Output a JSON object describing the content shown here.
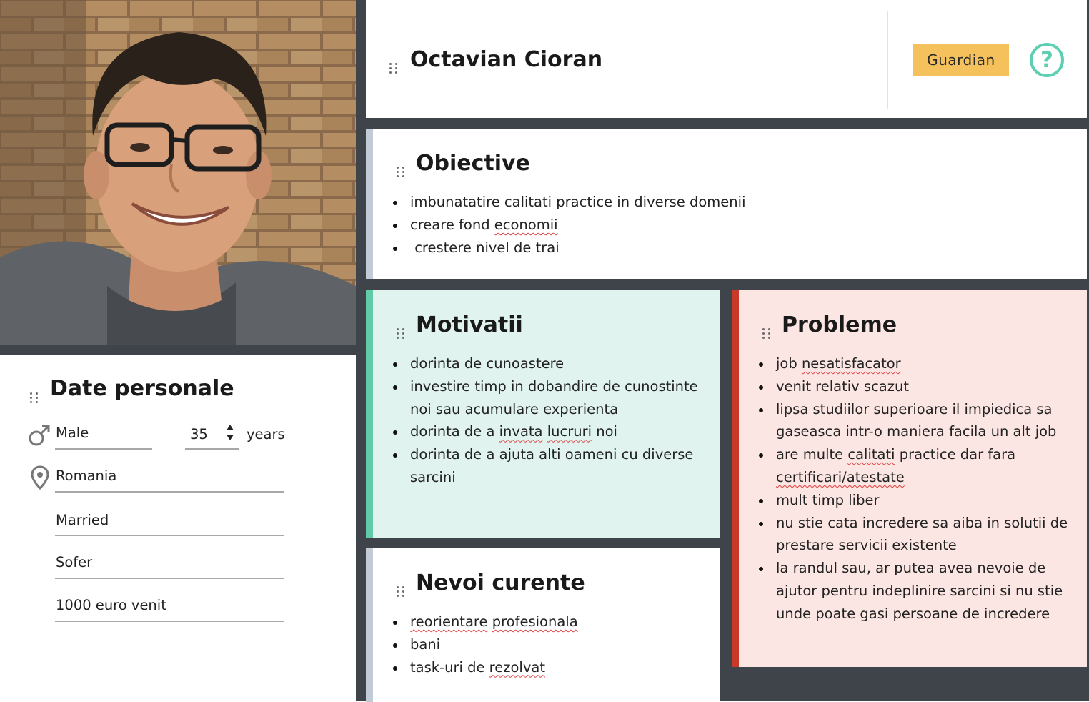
{
  "profile": {
    "name": "Octavian Cioran",
    "badge": "Guardian",
    "help_symbol": "?"
  },
  "photo": {
    "description_icon": "person-photo"
  },
  "personal": {
    "title": "Date personale",
    "gender": "Male",
    "age": "35",
    "age_unit": "years",
    "location": "Romania",
    "marital_status": "Married",
    "occupation": "Sofer",
    "income": "1000 euro venit"
  },
  "objectives": {
    "title": "Obiective",
    "items": [
      "imbunatatire calitati practice in diverse domenii",
      "creare fond economii",
      " crestere nivel de trai"
    ]
  },
  "motivations": {
    "title": "Motivatii",
    "items": [
      "dorinta de cunoastere",
      "investire timp in dobandire de cunostinte noi sau acumulare experienta",
      "dorinta de a invata lucruri noi",
      "dorinta de a ajuta alti oameni cu diverse sarcini"
    ]
  },
  "needs": {
    "title": "Nevoi curente",
    "items": [
      "reorientare profesionala",
      "bani",
      "task-uri de rezolvat"
    ]
  },
  "problems": {
    "title": "Probleme",
    "items": [
      "job nesatisfacator",
      "venit relativ scazut",
      "lipsa studiilor superioare il impiedica sa gaseasca intr-o maniera facila un alt job",
      "are multe calitati practice dar fara certificari/atestate",
      "mult timp liber",
      "nu stie cata incredere sa aiba in solutii de prestare servicii existente",
      "la randul sau, ar putea avea nevoie de ajutor pentru indeplinire sarcini si nu stie unde poate gasi persoane de incredere"
    ]
  },
  "colors": {
    "badge_bg": "#f4c15d",
    "help_icon": "#5ecfb3",
    "motivations_bg": "#e0f3ee",
    "motivations_accent": "#63caa8",
    "problems_bg": "#fce6e3",
    "problems_accent": "#c9392a",
    "neutral_accent": "#c3ccd6",
    "dark_frame": "#3f434a"
  }
}
